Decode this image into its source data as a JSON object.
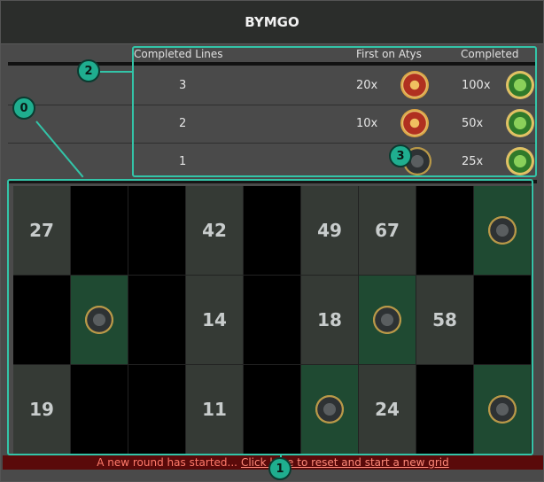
{
  "window": {
    "title": "BYMGO"
  },
  "table": {
    "headers": {
      "lines": "Completed Lines",
      "first": "First on Atys",
      "completed": "Completed"
    },
    "rows": [
      {
        "lines": "3",
        "first": "20x",
        "completed": "100x"
      },
      {
        "lines": "2",
        "first": "10x",
        "completed": "50x"
      },
      {
        "lines": "1",
        "first": "",
        "completed": "25x"
      }
    ]
  },
  "grid": {
    "cells": [
      {
        "label": "27",
        "state": "num"
      },
      {
        "label": "",
        "state": "empty"
      },
      {
        "label": "",
        "state": "empty"
      },
      {
        "label": "42",
        "state": "num"
      },
      {
        "label": "",
        "state": "empty"
      },
      {
        "label": "49",
        "state": "num"
      },
      {
        "label": "67",
        "state": "num"
      },
      {
        "label": "",
        "state": "empty"
      },
      {
        "label": "",
        "state": "marked"
      },
      {
        "label": "",
        "state": "empty"
      },
      {
        "label": "",
        "state": "marked"
      },
      {
        "label": "",
        "state": "empty"
      },
      {
        "label": "14",
        "state": "num"
      },
      {
        "label": "",
        "state": "empty"
      },
      {
        "label": "18",
        "state": "num"
      },
      {
        "label": "",
        "state": "marked"
      },
      {
        "label": "58",
        "state": "num"
      },
      {
        "label": "",
        "state": "empty"
      },
      {
        "label": "19",
        "state": "num"
      },
      {
        "label": "",
        "state": "empty"
      },
      {
        "label": "",
        "state": "empty"
      },
      {
        "label": "11",
        "state": "num"
      },
      {
        "label": "",
        "state": "empty"
      },
      {
        "label": "",
        "state": "marked"
      },
      {
        "label": "24",
        "state": "num"
      },
      {
        "label": "",
        "state": "empty"
      },
      {
        "label": "",
        "state": "marked"
      }
    ]
  },
  "status": {
    "message": "A new round has started...",
    "link": "Click here to reset and start a new grid"
  },
  "annotations": {
    "b0": "0",
    "b1": "1",
    "b2": "2",
    "b3": "3"
  },
  "colors": {
    "highlight": "#33c4a8",
    "marked_cell": "#1f4a32",
    "status_bg": "#5a0a0a"
  }
}
